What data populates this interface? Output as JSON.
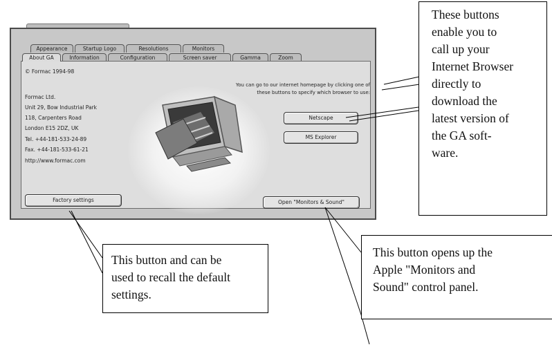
{
  "tabs_back": [
    "Appearance",
    "Startup Logo",
    "Resolutions",
    "Monitors"
  ],
  "tabs_front": [
    "About GA",
    "Information",
    "Configuration",
    "Screen saver",
    "Gamma",
    "Zoom"
  ],
  "about": {
    "copyright": "© Formac 1994-98",
    "address": [
      "Formac Ltd.",
      "Unit 29, Bow Industrial Park",
      "118, Carpenters Road",
      "London E15 2DZ, UK",
      "Tel. +44-181-533-24-89",
      "Fax. +44-181-533-61-21",
      "http://www.formac.com"
    ],
    "browser_note": "You can go to our internet homepage by clicking one of these buttons to specify which browser to use:"
  },
  "buttons": {
    "netscape": "Netscape",
    "ms_explorer": "MS Explorer",
    "factory_settings": "Factory settings",
    "open_monitors_sound": "Open \"Monitors & Sound\""
  },
  "callouts": {
    "browser_buttons": [
      "These buttons",
      "enable you to",
      "call up your",
      "Internet Browser",
      "directly to",
      "download the",
      "latest version of",
      "the GA soft-",
      "ware."
    ],
    "factory": [
      "This button and can be",
      "used to recall the default",
      "settings."
    ],
    "monitors": [
      "This button opens up the",
      "Apple \"Monitors and",
      "Sound\" control panel."
    ]
  }
}
